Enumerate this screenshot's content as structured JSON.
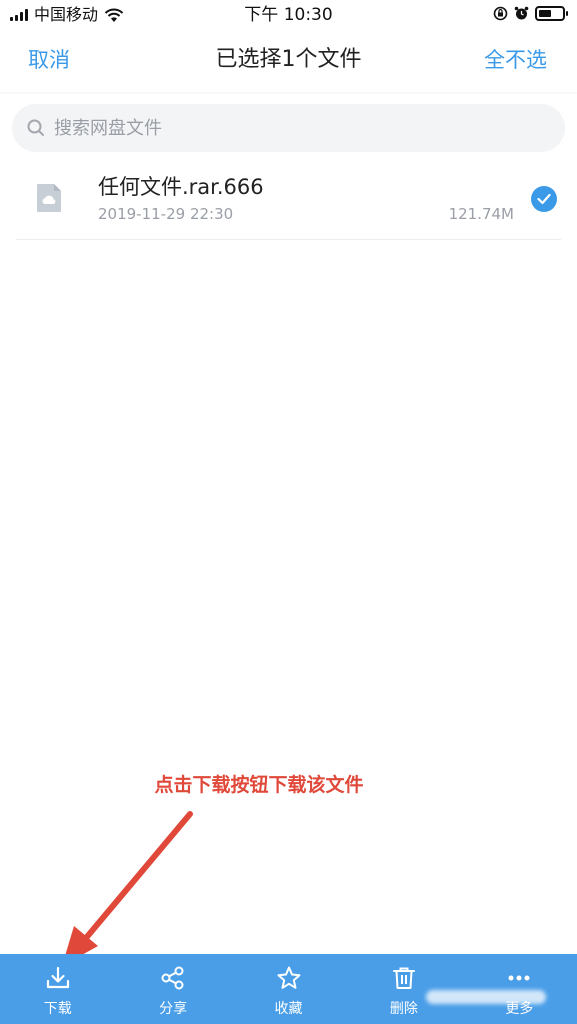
{
  "status_bar": {
    "carrier": "中国移动",
    "time": "下午 10:30"
  },
  "nav": {
    "cancel_label": "取消",
    "title": "已选择1个文件",
    "deselect_all_label": "全不选"
  },
  "search": {
    "placeholder": "搜索网盘文件"
  },
  "files": [
    {
      "name": "任何文件.rar.666",
      "date": "2019-11-29 22:30",
      "size": "121.74M",
      "selected": true,
      "icon": "cloud-file-icon"
    }
  ],
  "annotation": {
    "text": "点击下载按钮下载该文件",
    "color": "#e0493a"
  },
  "toolbar": {
    "items": [
      {
        "label": "下载",
        "icon": "download-icon"
      },
      {
        "label": "分享",
        "icon": "share-icon"
      },
      {
        "label": "收藏",
        "icon": "star-icon"
      },
      {
        "label": "删除",
        "icon": "trash-icon"
      },
      {
        "label": "更多",
        "icon": "more-icon"
      }
    ]
  },
  "colors": {
    "accent": "#3b9ae8",
    "toolbar_bg": "#4a9ee8"
  }
}
